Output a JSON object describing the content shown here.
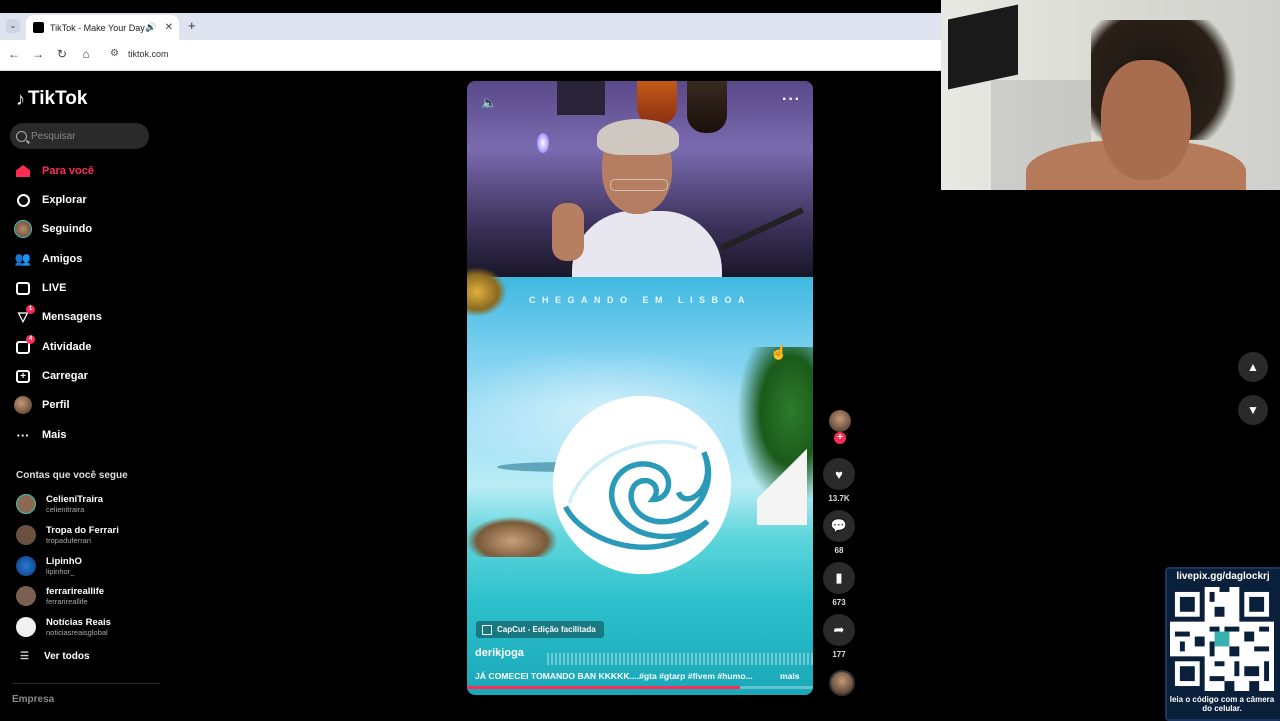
{
  "browser": {
    "tab_title": "TikTok - Make Your Day",
    "url": "tiktok.com",
    "new_tab": "+",
    "icons": [
      "back-icon",
      "forward-icon",
      "reload-icon",
      "home-icon",
      "tune-icon",
      "speaker-icon",
      "close-icon"
    ]
  },
  "sidebar": {
    "logo": "TikTok",
    "search_placeholder": "Pesquisar",
    "nav": [
      {
        "label": "Para você",
        "icon": "home-icon",
        "active": true
      },
      {
        "label": "Explorar",
        "icon": "compass-icon"
      },
      {
        "label": "Seguindo",
        "icon": "following-avatar-icon"
      },
      {
        "label": "Amigos",
        "icon": "friends-icon"
      },
      {
        "label": "LIVE",
        "icon": "live-icon"
      },
      {
        "label": "Mensagens",
        "icon": "messages-icon",
        "badge": "1"
      },
      {
        "label": "Atividade",
        "icon": "activity-icon",
        "badge": "4"
      },
      {
        "label": "Carregar",
        "icon": "upload-icon"
      },
      {
        "label": "Perfil",
        "icon": "profile-avatar-icon"
      },
      {
        "label": "Mais",
        "icon": "more-dots-icon"
      }
    ],
    "following_title": "Contas que você segue",
    "accounts": [
      {
        "name": "CelieniTraira",
        "handle": "celienitraira",
        "color": "#8a6a50"
      },
      {
        "name": "Tropa do Ferrari",
        "handle": "tropaduferrari",
        "color": "#6a5040"
      },
      {
        "name": "LipinhO",
        "handle": "lipinhor_",
        "color": "#2a7ad0"
      },
      {
        "name": "ferrarireallife",
        "handle": "ferrarireallife",
        "color": "#7a6050"
      },
      {
        "name": "Notícias Reais",
        "handle": "noticiasreaisglobal",
        "color": "#f0f0f0"
      }
    ],
    "see_all": "Ver todos",
    "footer": "Empresa"
  },
  "video": {
    "headline": "CHEGANDO EM LISBOA",
    "capcut": "CapCut - Edição facilitada",
    "author": "derikjoga",
    "caption": "JÁ COMECEI TOMANDO BAN KKKKK....#gta #gtarp #fivem #humo...",
    "more": "mais",
    "progress_fraction": 0.79
  },
  "actions": {
    "likes": "13.7K",
    "comments": "68",
    "saves": "673",
    "shares": "177"
  },
  "overlay": {
    "qr_url": "livepix.gg/daglockrj",
    "qr_caption": "leia o código com a câmera do celular."
  },
  "colors": {
    "accent": "#fe2c55",
    "background": "#000000"
  }
}
